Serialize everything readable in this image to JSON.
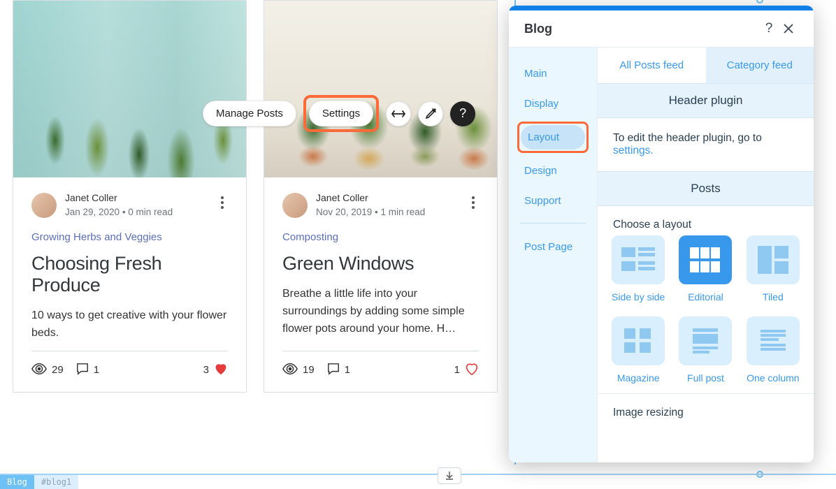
{
  "toolbar": {
    "manage_posts": "Manage Posts",
    "settings": "Settings"
  },
  "posts": [
    {
      "author": "Janet Coller",
      "meta": "Jan 29, 2020  •  0 min read",
      "category": "Growing Herbs and Veggies",
      "title": "Choosing Fresh Produce",
      "excerpt": "10 ways to get creative with your flower beds.",
      "views": "29",
      "comments": "1",
      "likes": "3",
      "liked": true
    },
    {
      "author": "Janet Coller",
      "meta": "Nov 20, 2019  •  1 min read",
      "category": "Composting",
      "title": "Green Windows",
      "excerpt": "Breathe a little life into your surroundings by adding some simple flower pots around your home. H…",
      "views": "19",
      "comments": "1",
      "likes": "1",
      "liked": false
    }
  ],
  "panel": {
    "title": "Blog",
    "nav": {
      "main": "Main",
      "display": "Display",
      "layout": "Layout",
      "design": "Design",
      "support": "Support",
      "post_page": "Post Page"
    },
    "tabs": {
      "all": "All Posts feed",
      "category": "Category feed"
    },
    "header_section": {
      "title": "Header plugin",
      "text_prefix": "To edit the header plugin, go to ",
      "link": "settings."
    },
    "posts_section": {
      "title": "Posts",
      "choose": "Choose a layout",
      "options": [
        "Side by side",
        "Editorial",
        "Tiled",
        "Magazine",
        "Full post",
        "One column"
      ],
      "image_resizing": "Image resizing"
    }
  },
  "editor": {
    "chip_label": "Blog",
    "element_id": "#blog1"
  }
}
